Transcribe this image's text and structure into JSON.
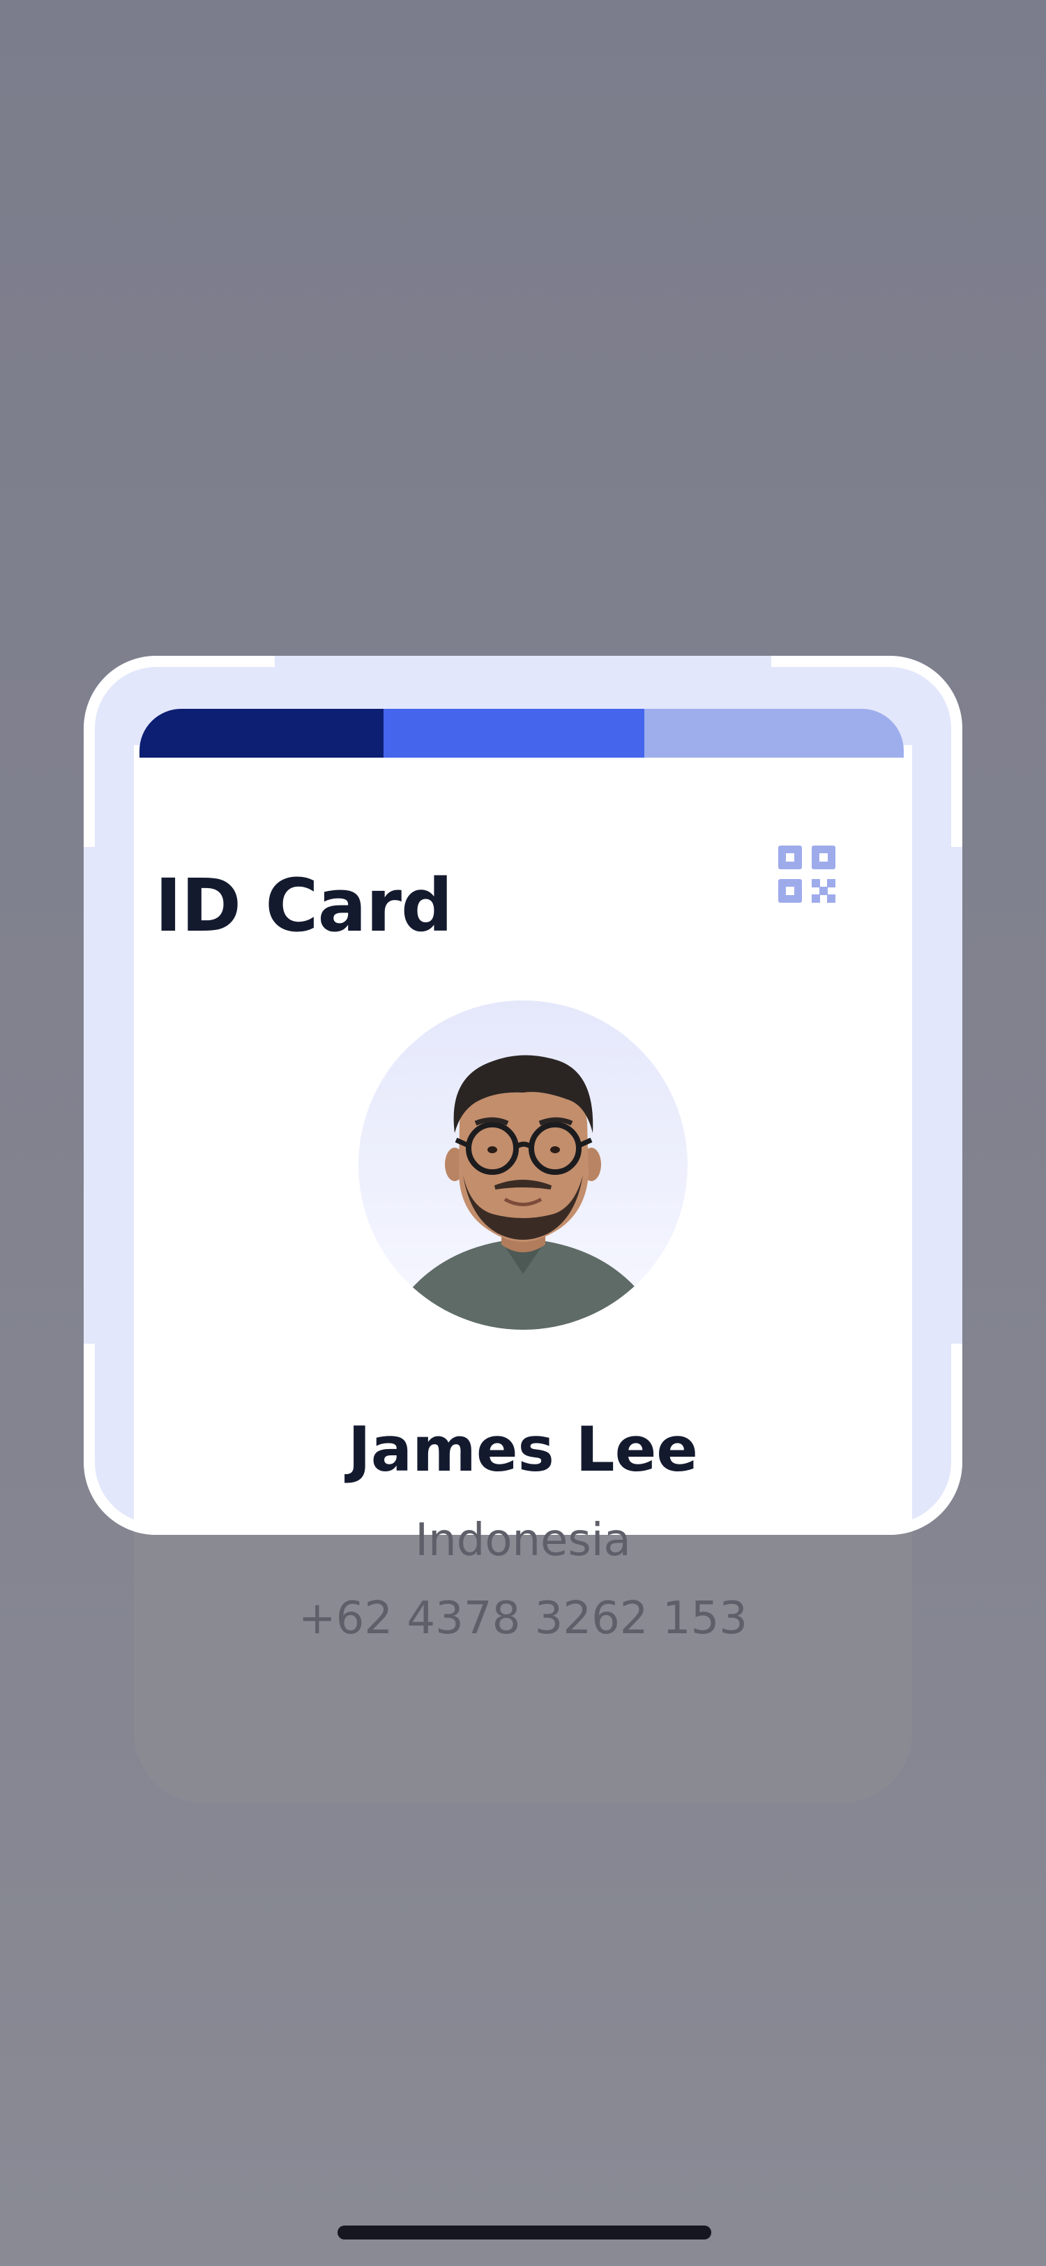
{
  "card": {
    "title": "ID Card",
    "name": "James Lee",
    "country": "Indonesia",
    "phone": "+62 4378 3262 153",
    "stripe_colors": [
      "#0c1f73",
      "#4566ec",
      "#9eaeed"
    ],
    "qr_icon": "qr-code-icon",
    "qr_color": "#9eabeb"
  },
  "scanner": {
    "frame_color": "#e3e7fb",
    "corner_color": "#ffffff"
  }
}
